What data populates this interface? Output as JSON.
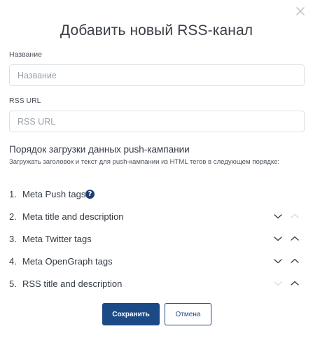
{
  "dialog": {
    "title": "Добавить новый RSS-канал"
  },
  "fields": {
    "name": {
      "label": "Название",
      "placeholder": "Название",
      "value": ""
    },
    "rss_url": {
      "label": "RSS URL",
      "placeholder": "RSS URL",
      "value": ""
    }
  },
  "order_section": {
    "title": "Порядок загрузки данных push-кампании",
    "description": "Загружать заголовок и текст для push-кампании из HTML тегов в следующем порядке:",
    "items": [
      {
        "num": "1.",
        "label": "Meta Push tags",
        "help_icon": "?",
        "down_enabled": false,
        "up_enabled": false
      },
      {
        "num": "2.",
        "label": "Meta title and description",
        "down_enabled": true,
        "up_enabled": false
      },
      {
        "num": "3.",
        "label": "Meta Twitter tags",
        "down_enabled": true,
        "up_enabled": true
      },
      {
        "num": "4.",
        "label": "Meta OpenGraph tags",
        "down_enabled": true,
        "up_enabled": true
      },
      {
        "num": "5.",
        "label": "RSS title and description",
        "down_enabled": false,
        "up_enabled": true
      }
    ]
  },
  "buttons": {
    "save_label": "Сохранить",
    "cancel_label": "Отмена"
  },
  "colors": {
    "primary": "#1c4a86",
    "arrow_enabled": "#3a3f47",
    "arrow_disabled": "#d6dbe0"
  }
}
